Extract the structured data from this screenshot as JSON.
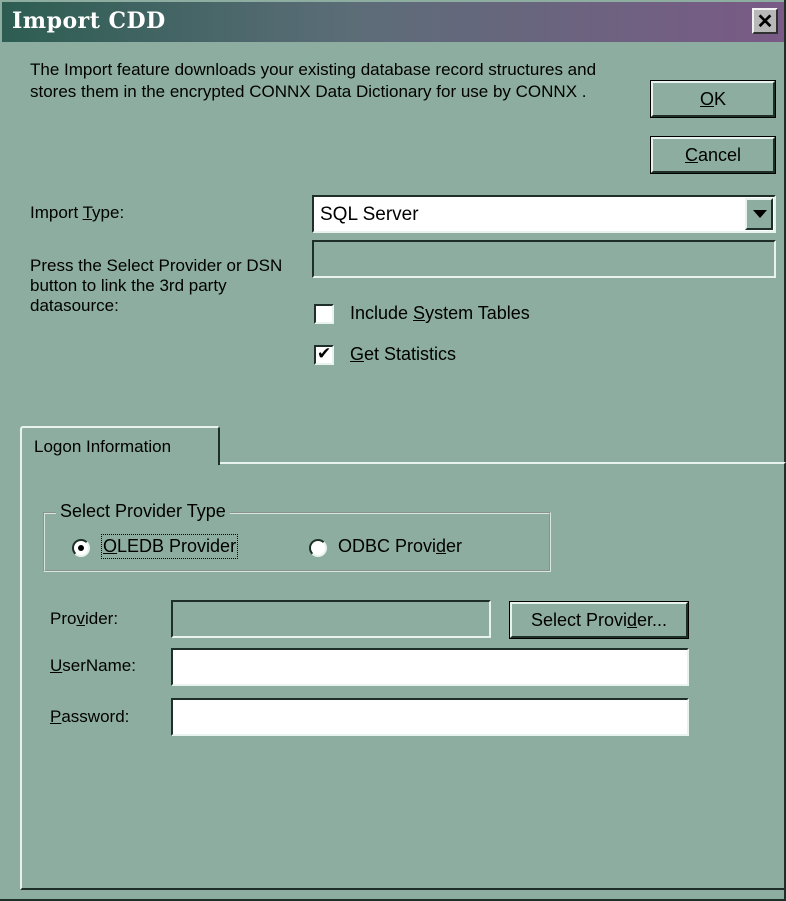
{
  "window": {
    "title": "Import CDD",
    "close_glyph": "✕"
  },
  "description": "The Import feature downloads your existing database record structures and stores them in the encrypted CONNX Data Dictionary for use by CONNX .",
  "buttons": {
    "ok": {
      "key": "O",
      "rest": "K"
    },
    "cancel": {
      "key": "C",
      "rest": "ancel"
    }
  },
  "import_type": {
    "pre": "Import ",
    "key": "T",
    "post": "ype:",
    "value": "SQL Server"
  },
  "provider_hint": "Press the Select Provider or DSN button to link the 3rd party datasource:",
  "checkboxes": {
    "include_system_tables": {
      "pre": "Include ",
      "key": "S",
      "post": "ystem Tables",
      "checked": false
    },
    "get_statistics": {
      "pre": "",
      "key": "G",
      "post": "et Statistics",
      "checked": true
    }
  },
  "tab": {
    "label": "Logon Information"
  },
  "provider_type": {
    "title": "Select Provider Type",
    "oledb": {
      "pre": "",
      "key": "O",
      "post": "LEDB Provider",
      "selected": true
    },
    "odbc": {
      "pre": "ODBC Provi",
      "key": "d",
      "post": "er",
      "selected": false
    }
  },
  "fields": {
    "provider": {
      "pre": "Pro",
      "key": "v",
      "post": "ider:",
      "value": ""
    },
    "select_provider": {
      "pre": "Select Provi",
      "key": "d",
      "post": "er..."
    },
    "username": {
      "pre": "",
      "key": "U",
      "post": "serName:",
      "value": ""
    },
    "password": {
      "pre": "",
      "key": "P",
      "post": "assword:",
      "value": ""
    }
  },
  "colors": {
    "face": "#8cada0",
    "title_start": "#2d5d52",
    "title_end": "#7a5a86"
  }
}
